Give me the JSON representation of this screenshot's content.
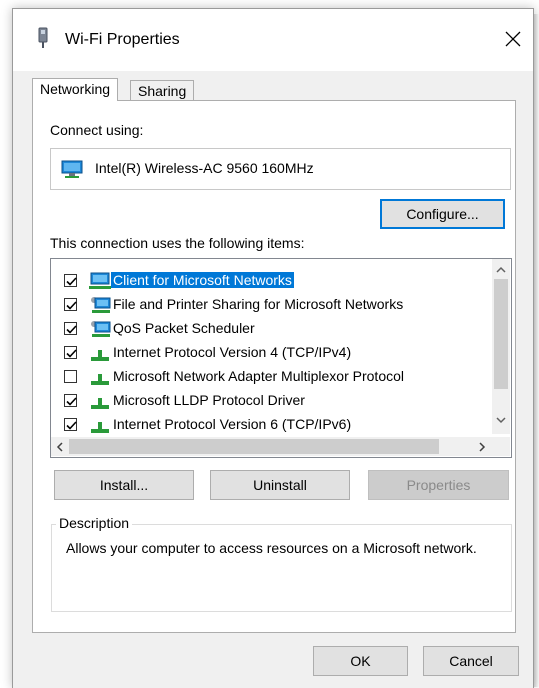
{
  "window": {
    "title": "Wi-Fi Properties",
    "close_symbol": "✕"
  },
  "tabs": [
    {
      "label": "Networking",
      "active": true
    },
    {
      "label": "Sharing",
      "active": false
    }
  ],
  "connect_using": {
    "label": "Connect using:",
    "adapter": "Intel(R) Wireless-AC 9560 160MHz",
    "configure_label": "Configure..."
  },
  "items": {
    "label": "This connection uses the following items:",
    "list": [
      {
        "label": "Client for Microsoft Networks",
        "checked": true,
        "selected": true,
        "icon": "network-client-icon"
      },
      {
        "label": "File and Printer Sharing for Microsoft Networks",
        "checked": true,
        "selected": false,
        "icon": "network-service-icon"
      },
      {
        "label": "QoS Packet Scheduler",
        "checked": true,
        "selected": false,
        "icon": "network-service-icon"
      },
      {
        "label": "Internet Protocol Version 4 (TCP/IPv4)",
        "checked": true,
        "selected": false,
        "icon": "protocol-icon"
      },
      {
        "label": "Microsoft Network Adapter Multiplexor Protocol",
        "checked": false,
        "selected": false,
        "icon": "protocol-icon"
      },
      {
        "label": "Microsoft LLDP Protocol Driver",
        "checked": true,
        "selected": false,
        "icon": "protocol-icon"
      },
      {
        "label": "Internet Protocol Version 6 (TCP/IPv6)",
        "checked": true,
        "selected": false,
        "icon": "protocol-icon"
      }
    ]
  },
  "buttons": {
    "install": "Install...",
    "uninstall": "Uninstall",
    "properties": "Properties",
    "ok": "OK",
    "cancel": "Cancel"
  },
  "description": {
    "legend": "Description",
    "text": "Allows your computer to access resources on a Microsoft network."
  },
  "colors": {
    "selection": "#0078d7",
    "focus_border": "#0078d7",
    "protocol_green": "#2a9a3a",
    "monitor_blue": "#1e88d8"
  }
}
